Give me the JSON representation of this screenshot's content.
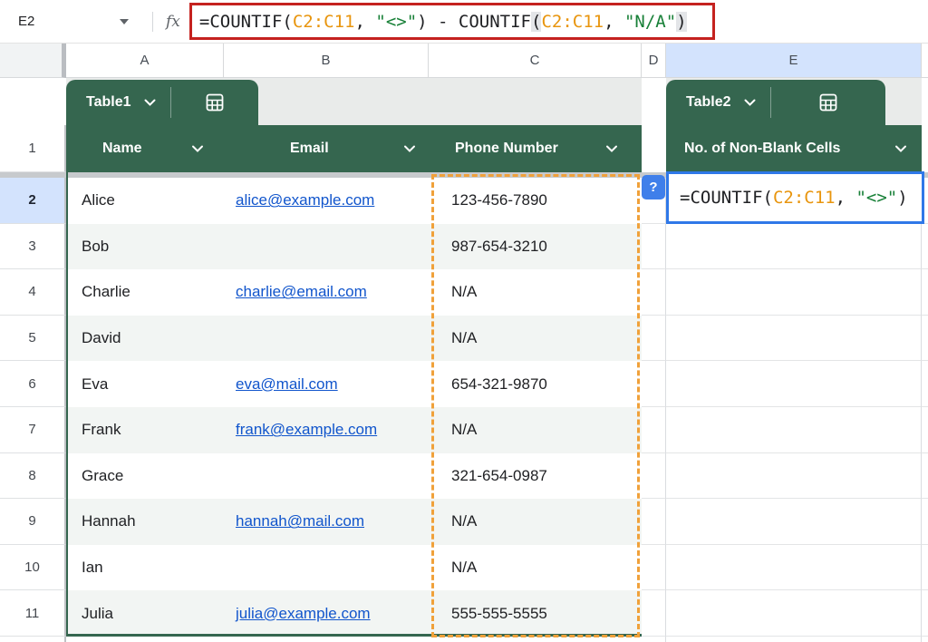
{
  "formula_bar": {
    "cell_ref": "E2",
    "fx_label": "fx",
    "formula": {
      "p1": "=COUNTIF(",
      "r1": "C2:C11",
      "c1": ", ",
      "s1": "\"<>\"",
      "p2": ")",
      "op": " - ",
      "f2": "COUNTIF",
      "p3": "(",
      "r2": "C2:C11",
      "c2": ", ",
      "s2": "\"N/A\"",
      "p4": ")"
    }
  },
  "column_letters": [
    "A",
    "B",
    "C",
    "D",
    "E"
  ],
  "tables": {
    "table1": {
      "chip_label": "Table1",
      "columns": [
        "Name",
        "Email",
        "Phone Number"
      ]
    },
    "table2": {
      "chip_label": "Table2",
      "columns": [
        "No. of Non-Blank Cells"
      ]
    }
  },
  "header_row_number": "1",
  "rows": [
    {
      "n": "2",
      "name": "Alice",
      "email": "alice@example.com",
      "phone": "123-456-7890"
    },
    {
      "n": "3",
      "name": "Bob",
      "email": "",
      "phone": "987-654-3210"
    },
    {
      "n": "4",
      "name": "Charlie",
      "email": "charlie@email.com",
      "phone": "N/A"
    },
    {
      "n": "5",
      "name": "David",
      "email": "",
      "phone": "N/A"
    },
    {
      "n": "6",
      "name": "Eva",
      "email": "eva@mail.com",
      "phone": "654-321-9870"
    },
    {
      "n": "7",
      "name": "Frank",
      "email": "frank@example.com",
      "phone": "N/A"
    },
    {
      "n": "8",
      "name": "Grace",
      "email": "",
      "phone": "321-654-0987"
    },
    {
      "n": "9",
      "name": "Hannah",
      "email": "hannah@mail.com",
      "phone": "N/A"
    },
    {
      "n": "10",
      "name": "Ian",
      "email": "",
      "phone": "N/A"
    },
    {
      "n": "11",
      "name": "Julia",
      "email": "julia@example.com",
      "phone": "555-555-5555"
    }
  ],
  "active_cell": {
    "ref": "E2",
    "help_badge": "?",
    "formula": {
      "p1": "=COUNTIF(",
      "r1": "C2:C11",
      "c1": ", ",
      "s1": "\"<>\"",
      "p2": ")"
    }
  },
  "icons": {
    "name_box_arrow": "dropdown-triangle",
    "header_filter": "chevron-down",
    "table_chip": "table-grid"
  },
  "colors": {
    "table_green": "#35664f",
    "band_grey": "#f2f5f3",
    "selected_header_blue": "#d3e3fd",
    "red_highlight_border": "#c5221f",
    "edit_border_blue": "#2f78e8",
    "range_reference_orange": "#e8950e",
    "string_literal_green": "#188038",
    "range_dash_orange": "#f0a13a",
    "link_blue": "#1155cc"
  }
}
